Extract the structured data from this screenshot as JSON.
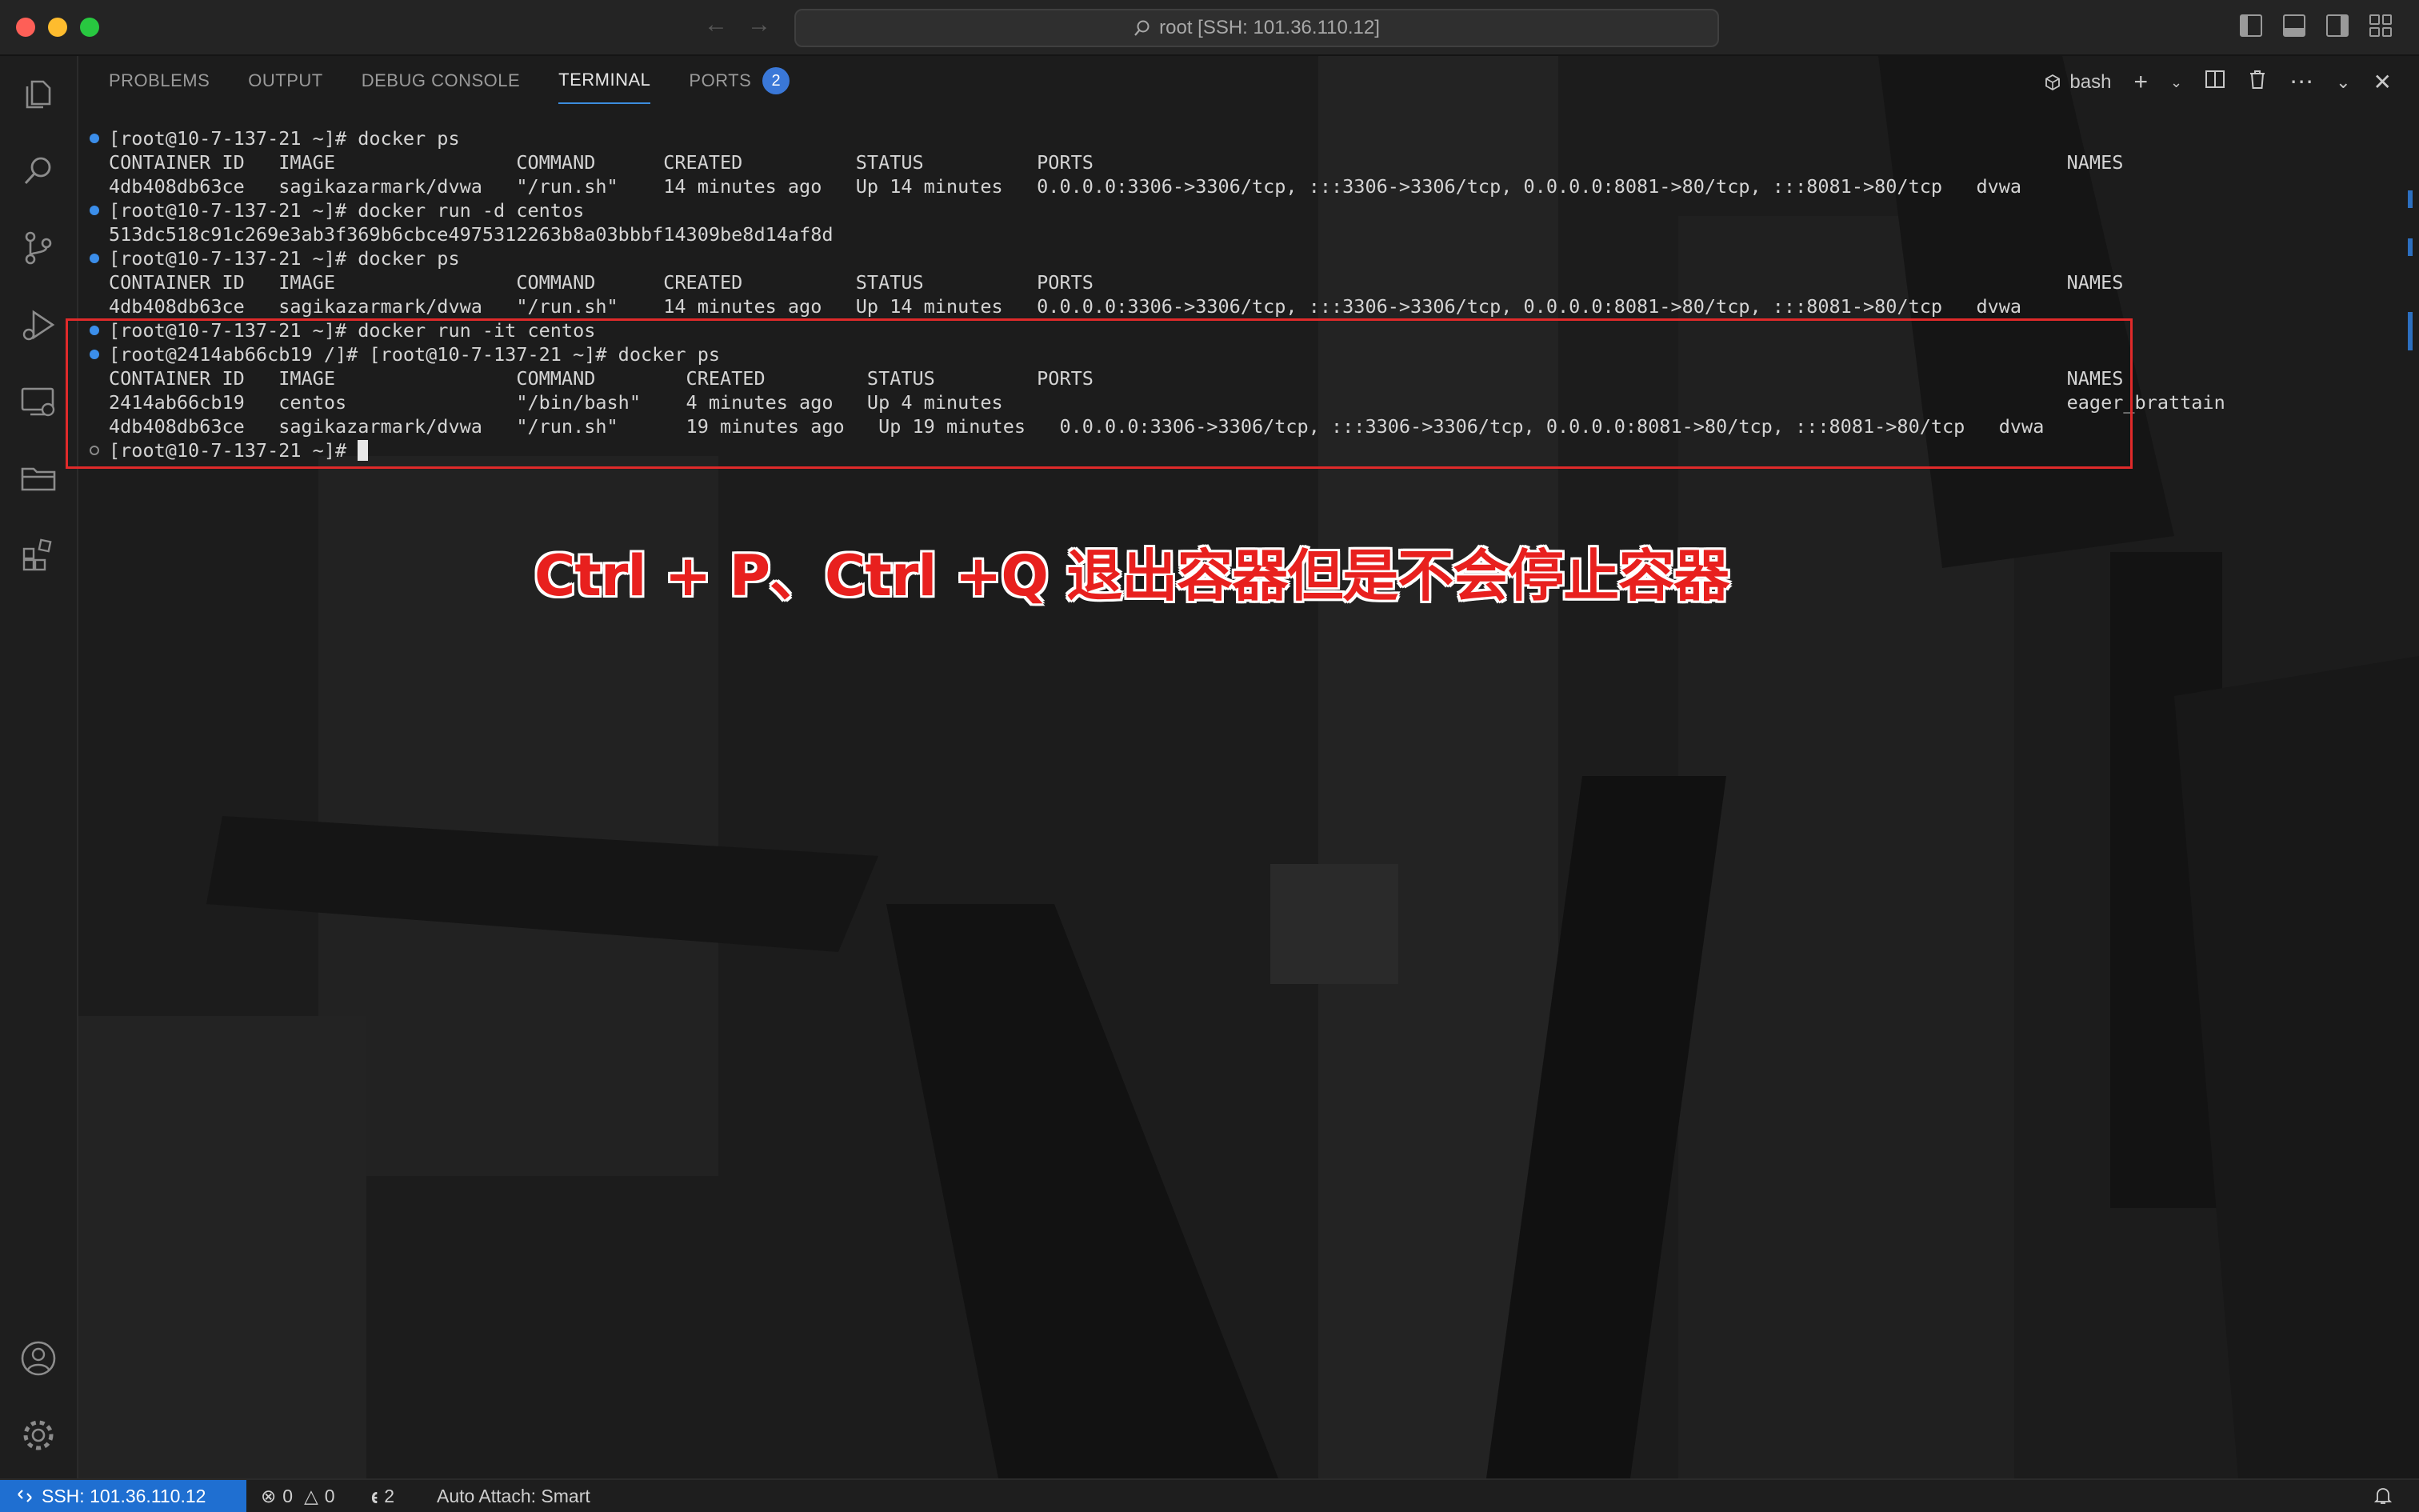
{
  "window": {
    "command_center": "root [SSH: 101.36.110.12]"
  },
  "panel": {
    "tabs": [
      {
        "label": "PROBLEMS"
      },
      {
        "label": "OUTPUT"
      },
      {
        "label": "DEBUG CONSOLE"
      },
      {
        "label": "TERMINAL",
        "active": true
      },
      {
        "label": "PORTS",
        "badge": "2"
      }
    ],
    "shell_label": "bash"
  },
  "terminal": {
    "lines": [
      {
        "marker": "filled",
        "text": "[root@10-7-137-21 ~]# docker ps"
      },
      {
        "marker": "none",
        "text": "CONTAINER ID   IMAGE                COMMAND      CREATED          STATUS          PORTS                                                                                      NAMES"
      },
      {
        "marker": "none",
        "text": "4db408db63ce   sagikazarmark/dvwa   \"/run.sh\"    14 minutes ago   Up 14 minutes   0.0.0.0:3306->3306/tcp, :::3306->3306/tcp, 0.0.0.0:8081->80/tcp, :::8081->80/tcp   dvwa"
      },
      {
        "marker": "filled",
        "text": "[root@10-7-137-21 ~]# docker run -d centos"
      },
      {
        "marker": "none",
        "text": "513dc518c91c269e3ab3f369b6cbce4975312263b8a03bbbf14309be8d14af8d"
      },
      {
        "marker": "filled",
        "text": "[root@10-7-137-21 ~]# docker ps"
      },
      {
        "marker": "none",
        "text": "CONTAINER ID   IMAGE                COMMAND      CREATED          STATUS          PORTS                                                                                      NAMES"
      },
      {
        "marker": "none",
        "text": "4db408db63ce   sagikazarmark/dvwa   \"/run.sh\"    14 minutes ago   Up 14 minutes   0.0.0.0:3306->3306/tcp, :::3306->3306/tcp, 0.0.0.0:8081->80/tcp, :::8081->80/tcp   dvwa"
      },
      {
        "marker": "filled",
        "text": "[root@10-7-137-21 ~]# docker run -it centos"
      },
      {
        "marker": "filled",
        "text": "[root@2414ab66cb19 /]# [root@10-7-137-21 ~]# docker ps"
      },
      {
        "marker": "none",
        "text": "CONTAINER ID   IMAGE                COMMAND        CREATED         STATUS         PORTS                                                                                      NAMES"
      },
      {
        "marker": "none",
        "text": "2414ab66cb19   centos               \"/bin/bash\"    4 minutes ago   Up 4 minutes                                                                                              eager_brattain"
      },
      {
        "marker": "none",
        "text": "4db408db63ce   sagikazarmark/dvwa   \"/run.sh\"      19 minutes ago   Up 19 minutes   0.0.0.0:3306->3306/tcp, :::3306->3306/tcp, 0.0.0.0:8081->80/tcp, :::8081->80/tcp   dvwa"
      },
      {
        "marker": "hollow",
        "text": "[root@10-7-137-21 ~]# ",
        "cursor": true
      }
    ]
  },
  "annotation": {
    "text": "Ctrl + P、Ctrl +Q 退出容器但是不会停止容器",
    "color": "#e8201e"
  },
  "statusbar": {
    "remote": "SSH: 101.36.110.12",
    "errors": "0",
    "warnings": "0",
    "ports": "2",
    "auto_attach": "Auto Attach: Smart"
  },
  "colors": {
    "accent": "#3c8dde",
    "remote_bg": "#1f6fd1",
    "highlight_box": "#e02a2a"
  }
}
